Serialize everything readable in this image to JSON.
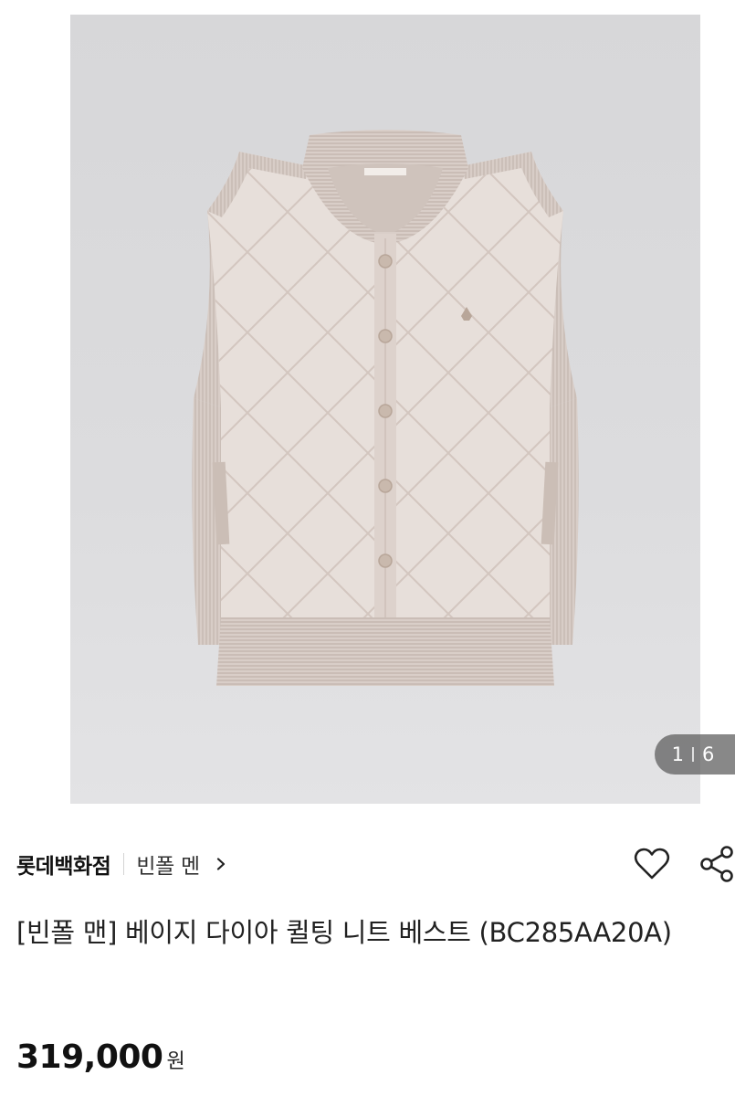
{
  "gallery": {
    "image_alt": "베이지 다이아 퀼팅 니트 베스트",
    "current_index": "1",
    "total": "6"
  },
  "product": {
    "store": "롯데백화점",
    "brand": "빈폴 멘",
    "title": "[빈폴 맨] 베이지 다이아 퀼팅 니트 베스트 (BC285AA20A)",
    "price": "319,000",
    "currency": "원"
  },
  "icons": {
    "chevron": "chevron-right-icon",
    "like": "heart-icon",
    "share": "share-icon"
  },
  "colors": {
    "photo_background": "#d9d9db",
    "vest": "#e6dcd6",
    "counter_bg": "#5a5a5a"
  }
}
